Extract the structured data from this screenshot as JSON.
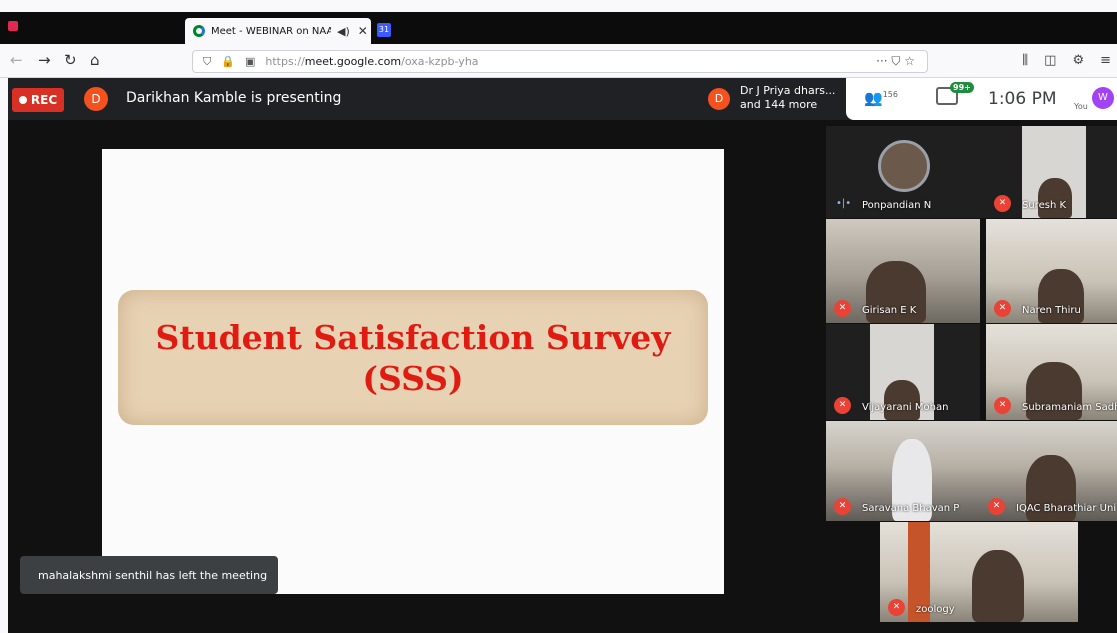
{
  "browser": {
    "tab_title": "Meet - WEBINAR on NAAC",
    "tab_audio_icon": "speaker-icon",
    "tab_close": "✕",
    "second_tab_icon": "31",
    "url_prefix": "https://",
    "url_host": "meet.google.com",
    "url_path": "/oxa-kzpb-yha",
    "url_actions": "··· ⛉ ☆"
  },
  "meet": {
    "rec_label": "REC",
    "presenter_initial": "D",
    "presenter_text": "Darikhan Kamble is presenting",
    "participants_initial": "D",
    "participants_line1": "Dr J Priya dhars...",
    "participants_line2": "and 144 more",
    "people_count": "156",
    "chat_badge": "99+",
    "time": "1:06 PM",
    "you_label": "You",
    "you_initial": "W"
  },
  "slide": {
    "line1": "Student Satisfaction Survey",
    "line2": "(SSS)"
  },
  "toast": "mahalakshmi senthil has left the meeting",
  "tiles": [
    {
      "name": "Ponpandian N"
    },
    {
      "name": "Suresh K"
    },
    {
      "name": "Girisan E K"
    },
    {
      "name": "Naren Thiru"
    },
    {
      "name": "Vijayarani Mohan"
    },
    {
      "name": "Subramaniam Sadha"
    },
    {
      "name": "Saravana Bhavan P"
    },
    {
      "name": "IQAC Bharathiar Uni"
    },
    {
      "name": "zoology"
    }
  ],
  "colors": {
    "rec_red": "#d93025",
    "slide_title_red": "#e01b12",
    "avatar_orange": "#f4511e",
    "mute_red": "#ea4335"
  }
}
